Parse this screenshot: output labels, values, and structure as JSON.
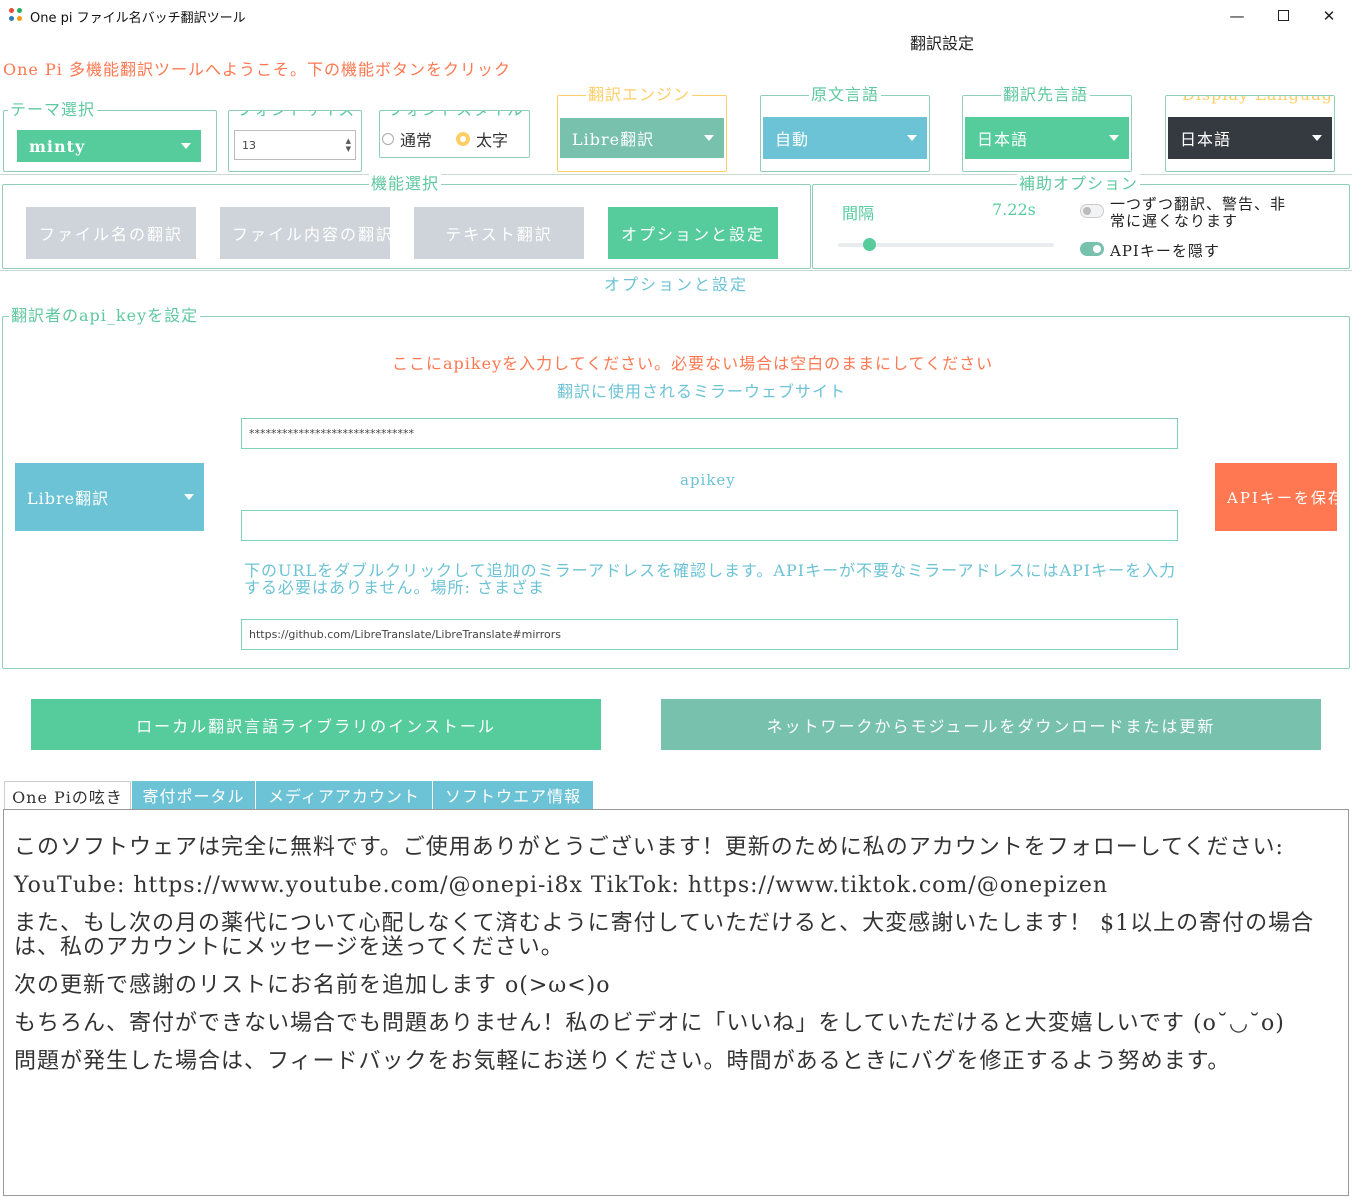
{
  "window": {
    "title": "One pi ファイル名バッチ翻訳ツール",
    "header_center": "翻訳設定",
    "welcome": "One Pi 多機能翻訳ツールへようこそ。下の機能ボタンをクリック"
  },
  "settings": {
    "theme": {
      "label": "テーマ選択",
      "value": "minty"
    },
    "font_size": {
      "label": "フォントサイズ",
      "value": "13"
    },
    "font_style": {
      "label": "フォントスタイル",
      "options": [
        "通常",
        "太字"
      ],
      "selected": "太字"
    },
    "engine": {
      "label": "翻訳エンジン",
      "value": "Libre翻訳"
    },
    "source_lang": {
      "label": "原文言語",
      "value": "自動"
    },
    "target_lang": {
      "label": "翻訳先言語",
      "value": "日本語"
    },
    "display_lang": {
      "label": "Display Language",
      "value": "日本語"
    }
  },
  "functions": {
    "label": "機能選択",
    "buttons": [
      "ファイル名の翻訳",
      "ファイル内容の翻訳",
      "テキスト翻訳",
      "オプションと設定"
    ],
    "active": "オプションと設定"
  },
  "aux": {
    "label": "補助オプション",
    "interval_label": "間隔",
    "interval_value": "7.22s",
    "toggle1_label": "一つずつ翻訳、警告、非常に遅くなります",
    "toggle1_on": false,
    "toggle2_label": "APIキーを隠す",
    "toggle2_on": true
  },
  "section_title": "オプションと設定",
  "api": {
    "group_label": "翻訳者のapi_keyを設定",
    "hint": "ここにapikeyを入力してください。必要ない場合は空白のままにしてください",
    "mirror_label": "翻訳に使用されるミラーウェブサイト",
    "mirror_value": "******************************",
    "apikey_label": "apikey",
    "apikey_value": "",
    "engine_value": "Libre翻訳",
    "save_button": "APIキーを保存",
    "url_note": "下のURLをダブルクリックして追加のミラーアドレスを確認します。APIキーが不要なミラーアドレスにはAPIキーを入力する必要はありません。場所: さまざま",
    "url_value": "https://github.com/LibreTranslate/LibreTranslate#mirrors"
  },
  "actions": {
    "install": "ローカル翻訳言語ライブラリのインストール",
    "download": "ネットワークからモジュールをダウンロードまたは更新"
  },
  "tabs": [
    "One Piの呟き",
    "寄付ポータル",
    "メディアアカウント",
    "ソフトウエア情報"
  ],
  "note": {
    "p1": "このソフトウェアは完全に無料です。ご使用ありがとうございます！更新のために私のアカウントをフォローしてください:",
    "p2": "YouTube: https://www.youtube.com/@onepi-i8x TikTok: https://www.tiktok.com/@onepizen",
    "p3": "また、もし次の月の薬代について心配しなくて済むように寄付していただけると、大変感謝いたします！ $1以上の寄付の場合は、私のアカウントにメッセージを送ってください。",
    "p4": "次の更新で感謝のリストにお名前を追加します o(>ω<)o",
    "p5": "もちろん、寄付ができない場合でも問題ありません！私のビデオに「いいね」をしていただけると大変嬉しいです (o˘◡˘o)",
    "p6": "問題が発生した場合は、フィードバックをお気軽にお送りください。時間があるときにバグを修正するよう努めます。"
  },
  "colors": {
    "mint": "#56cc9d",
    "teal": "#78c2ad",
    "cyan": "#6cc3d5",
    "coral": "#ff7851",
    "gray": "#ced4da",
    "dark": "#343a40",
    "warning": "#ffce67"
  }
}
